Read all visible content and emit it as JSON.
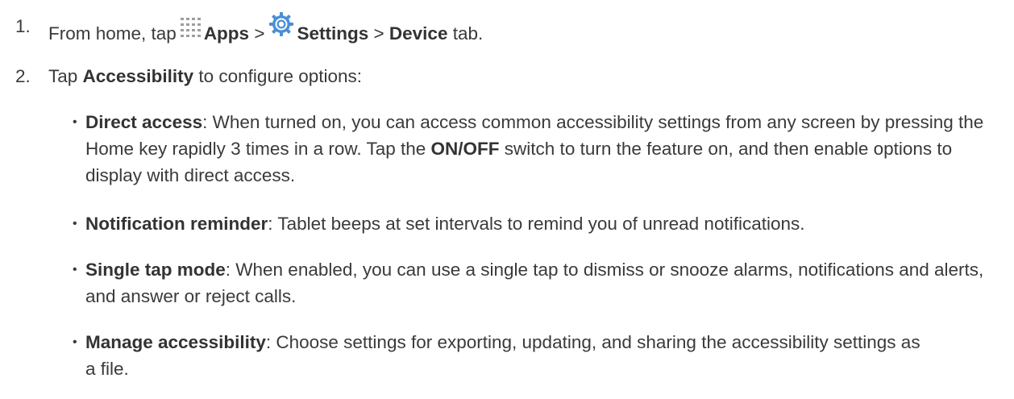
{
  "steps": [
    {
      "number": "1.",
      "text_from": "From home, tap",
      "apps": "Apps",
      "sep1": ">",
      "settings": "Settings",
      "sep2": ">",
      "device": "Device",
      "tab": "tab."
    },
    {
      "number": "2.",
      "text_tap": "Tap",
      "accessibility": "Accessibility",
      "text_rest": "to configure options:"
    }
  ],
  "bullets": [
    {
      "term": "Direct access",
      "desc_1": ": When turned on, you can access common accessibility settings from any screen by pressing the Home key rapidly 3 times in a row. Tap the ",
      "bold_mid": "ON/OFF",
      "desc_2": " switch to turn the feature on, and then enable options to display with direct access."
    },
    {
      "term": "Notification reminder",
      "desc_1": ": Tablet beeps at set intervals to remind you of unread notifications."
    },
    {
      "term": "Single tap mode",
      "desc_1": ": When enabled, you can use a single tap to dismiss or snooze alarms, notifications and alerts, and answer or reject calls."
    },
    {
      "term": "Manage accessibility",
      "desc_1": ": Choose settings for exporting, updating, and sharing the accessibility settings as a file."
    }
  ],
  "icons": {
    "apps": "apps-grid-icon",
    "settings": "settings-gear-icon"
  },
  "colors": {
    "text": "#3a3a3a",
    "apps_icon": "#9e9e9e",
    "settings_icon": "#4a8fd6"
  }
}
